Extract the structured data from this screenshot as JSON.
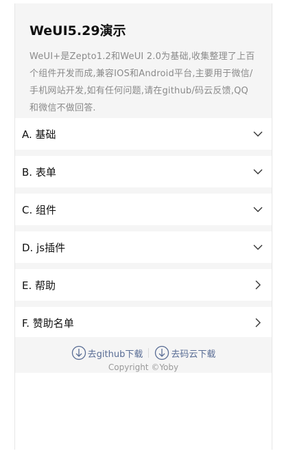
{
  "header": {
    "title": "WeUI5.29演示",
    "description": "WeUI+是Zepto1.2和WeUI 2.0为基础,收集整理了上百个组件开发而成,兼容IOS和Android平台,主要用于微信/手机网站开发,如有任何问题,请在github/码云反馈,QQ和微信不做回答."
  },
  "menu": [
    {
      "label": "A. 基础",
      "icon": "chevron-down-icon"
    },
    {
      "label": "B. 表单",
      "icon": "chevron-down-icon"
    },
    {
      "label": "C. 组件",
      "icon": "chevron-down-icon"
    },
    {
      "label": "D. js插件",
      "icon": "chevron-down-icon"
    },
    {
      "label": "E. 帮助",
      "icon": "chevron-right-icon"
    },
    {
      "label": "F. 赞助名单",
      "icon": "chevron-right-icon"
    }
  ],
  "footer": {
    "github_label": "去github下载",
    "gitee_label": "去码云下载",
    "copyright": "Copyright ©Yoby",
    "link_color": "#586c94"
  }
}
